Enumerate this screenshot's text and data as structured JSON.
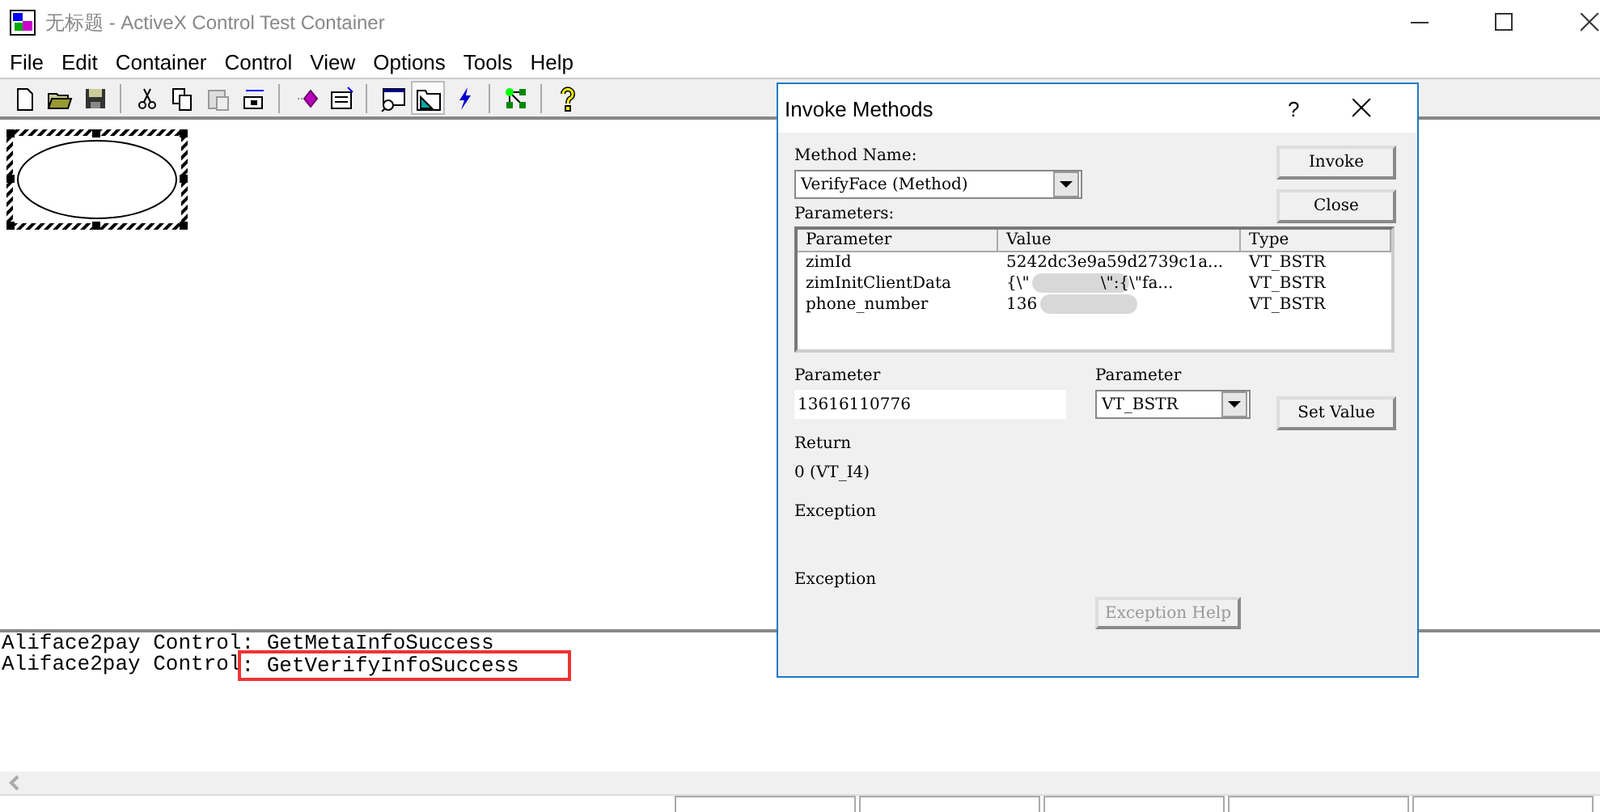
{
  "window": {
    "title": "无标题 - ActiveX Control Test Container"
  },
  "menu": [
    "File",
    "Edit",
    "Container",
    "Control",
    "View",
    "Options",
    "Tools",
    "Help"
  ],
  "toolbar": [
    {
      "kind": "new",
      "selected": false
    },
    {
      "kind": "open",
      "selected": false
    },
    {
      "kind": "save",
      "selected": false
    },
    {
      "kind": "sep"
    },
    {
      "kind": "cut",
      "selected": false
    },
    {
      "kind": "copy",
      "selected": false
    },
    {
      "kind": "paste",
      "selected": false
    },
    {
      "kind": "insert",
      "selected": false
    },
    {
      "kind": "sep"
    },
    {
      "kind": "gem",
      "selected": false
    },
    {
      "kind": "props",
      "selected": false
    },
    {
      "kind": "sep"
    },
    {
      "kind": "inspect",
      "selected": false
    },
    {
      "kind": "folder",
      "selected": true
    },
    {
      "kind": "bolt",
      "selected": false
    },
    {
      "kind": "sep"
    },
    {
      "kind": "tree",
      "selected": false
    },
    {
      "kind": "sep"
    },
    {
      "kind": "help",
      "selected": false
    }
  ],
  "log": [
    {
      "source": "Aliface2pay Control",
      "event": ": GetMetaInfoSuccess",
      "highlighted": false
    },
    {
      "source": "Aliface2pay Control",
      "event": ": GetVerifyInfoSuccess",
      "highlighted": true
    }
  ],
  "dialog": {
    "title": "Invoke Methods",
    "help": "?",
    "method_label": "Method Name:",
    "method": "VerifyFace (Method)",
    "parameters_label": "Parameters:",
    "columns": [
      "Parameter",
      "Value",
      "Type"
    ],
    "rows": [
      {
        "name": "zimId",
        "value": "5242dc3e9a59d2739c1a...",
        "type": "VT_BSTR"
      },
      {
        "name": "zimInitClientData",
        "value": "{\\\"",
        "value_tail": "\\\":{\\\"fa...",
        "type": "VT_BSTR",
        "blurred": true
      },
      {
        "name": "phone_number",
        "value": "136",
        "type": "VT_BSTR",
        "blurred": true
      }
    ],
    "param_label": "Parameter",
    "param_value": "13616110776",
    "type_label": "Parameter",
    "type_value": "VT_BSTR",
    "return_label": "Return",
    "return_value": "0 (VT_I4)",
    "exception_label": "Exception",
    "exception2_label": "Exception",
    "buttons": [
      {
        "label": "Invoke",
        "disabled": false
      },
      {
        "label": "Close",
        "disabled": false
      }
    ],
    "set_value": "Set Value",
    "exception_help": {
      "label": "Exception Help",
      "disabled": true
    }
  }
}
